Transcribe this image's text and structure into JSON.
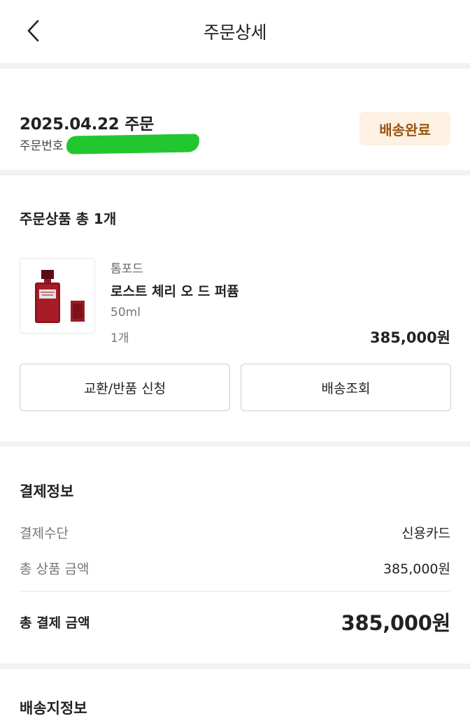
{
  "header": {
    "title": "주문상세",
    "back_icon": "chevron-left-icon"
  },
  "order": {
    "date_label": "2025.04.22 주문",
    "number_label": "주문번호",
    "status": "배송완료",
    "status_color": "#9a5410",
    "status_bg": "#fdf1e3"
  },
  "products": {
    "title": "주문상품 총 1개",
    "items": [
      {
        "brand": "톰포드",
        "name": "로스트 체리 오 드 퍼퓸",
        "option": "50ml",
        "quantity": "1개",
        "price": "385,000원",
        "image": "perfume-bottle-image"
      }
    ],
    "exchange_button": "교환/반품 신청",
    "tracking_button": "배송조회"
  },
  "payment": {
    "title": "결제정보",
    "method_label": "결제수단",
    "method_value": "신용카드",
    "subtotal_label": "총 상품 금액",
    "subtotal_value": "385,000원",
    "total_label": "총 결제 금액",
    "total_value": "385,000원"
  },
  "shipping": {
    "title": "배송지정보"
  }
}
